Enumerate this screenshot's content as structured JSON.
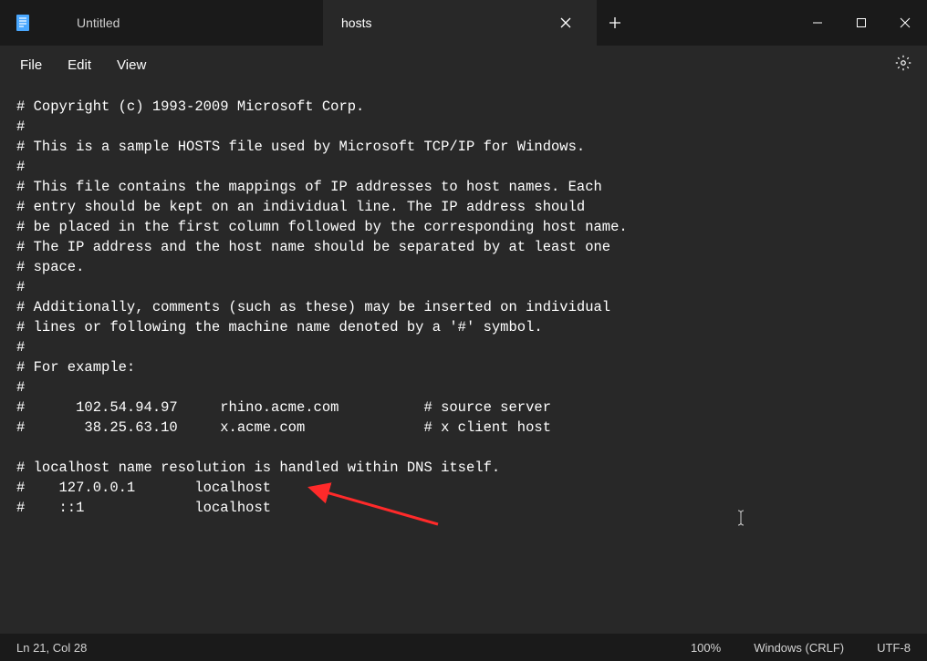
{
  "tabs": [
    {
      "label": "Untitled",
      "active": false
    },
    {
      "label": "hosts",
      "active": true
    }
  ],
  "menu": {
    "file": "File",
    "edit": "Edit",
    "view": "View"
  },
  "editor_lines": [
    "# Copyright (c) 1993-2009 Microsoft Corp.",
    "#",
    "# This is a sample HOSTS file used by Microsoft TCP/IP for Windows.",
    "#",
    "# This file contains the mappings of IP addresses to host names. Each",
    "# entry should be kept on an individual line. The IP address should",
    "# be placed in the first column followed by the corresponding host name.",
    "# The IP address and the host name should be separated by at least one",
    "# space.",
    "#",
    "# Additionally, comments (such as these) may be inserted on individual",
    "# lines or following the machine name denoted by a '#' symbol.",
    "#",
    "# For example:",
    "#",
    "#      102.54.94.97     rhino.acme.com          # source server",
    "#       38.25.63.10     x.acme.com              # x client host",
    "",
    "# localhost name resolution is handled within DNS itself.",
    "#    127.0.0.1       localhost",
    "#    ::1             localhost"
  ],
  "status": {
    "position": "Ln 21, Col 28",
    "zoom": "100%",
    "line_ending": "Windows (CRLF)",
    "encoding": "UTF-8"
  }
}
